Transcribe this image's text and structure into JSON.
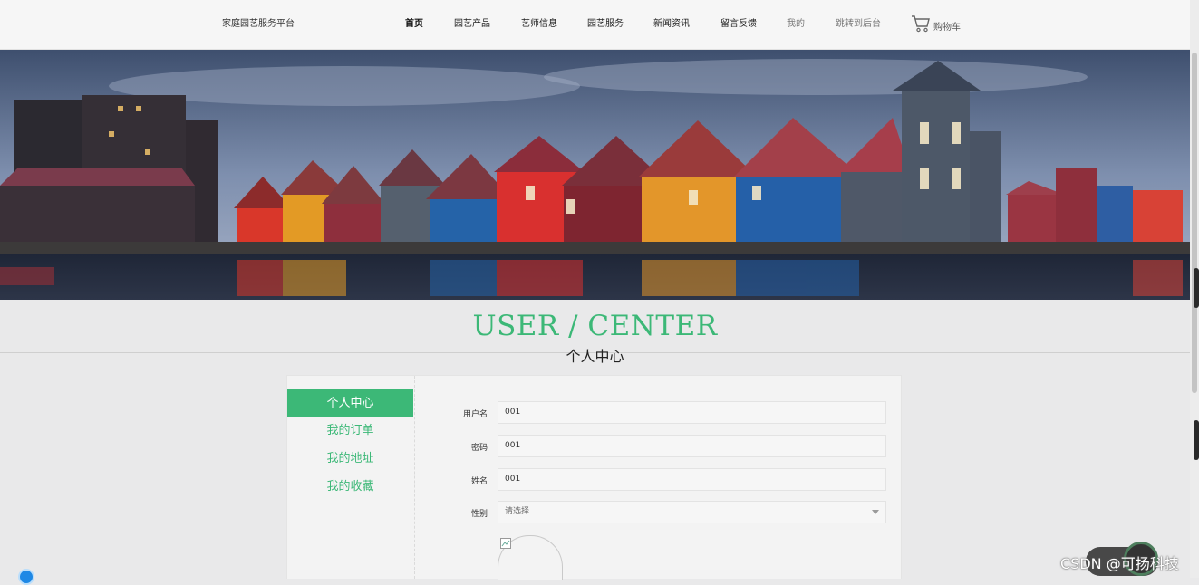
{
  "brand": "家庭园艺服务平台",
  "nav": [
    {
      "label": "首页"
    },
    {
      "label": "园艺产品"
    },
    {
      "label": "艺师信息"
    },
    {
      "label": "园艺服务"
    },
    {
      "label": "新闻资讯"
    },
    {
      "label": "留言反馈"
    },
    {
      "label": "我的"
    },
    {
      "label": "跳转到后台"
    }
  ],
  "cart_label": "购物车",
  "section": {
    "title_en": "USER / CENTER",
    "title_cn": "个人中心"
  },
  "sidebar": {
    "items": [
      {
        "label": "个人中心"
      },
      {
        "label": "我的订单"
      },
      {
        "label": "我的地址"
      },
      {
        "label": "我的收藏"
      }
    ]
  },
  "form": {
    "username_label": "用户名",
    "username_value": "001",
    "password_label": "密码",
    "password_value": "001",
    "name_label": "姓名",
    "name_value": "001",
    "gender_label": "性别",
    "gender_placeholder": "请选择"
  },
  "watermark": "CSDN @可扬科技",
  "colors": {
    "accent": "#3cb877",
    "nav_bg": "#f6f6f6",
    "page_bg": "#e9e9ea"
  },
  "icons": [
    "cart-icon",
    "chevron-down-icon",
    "broken-image-icon"
  ]
}
